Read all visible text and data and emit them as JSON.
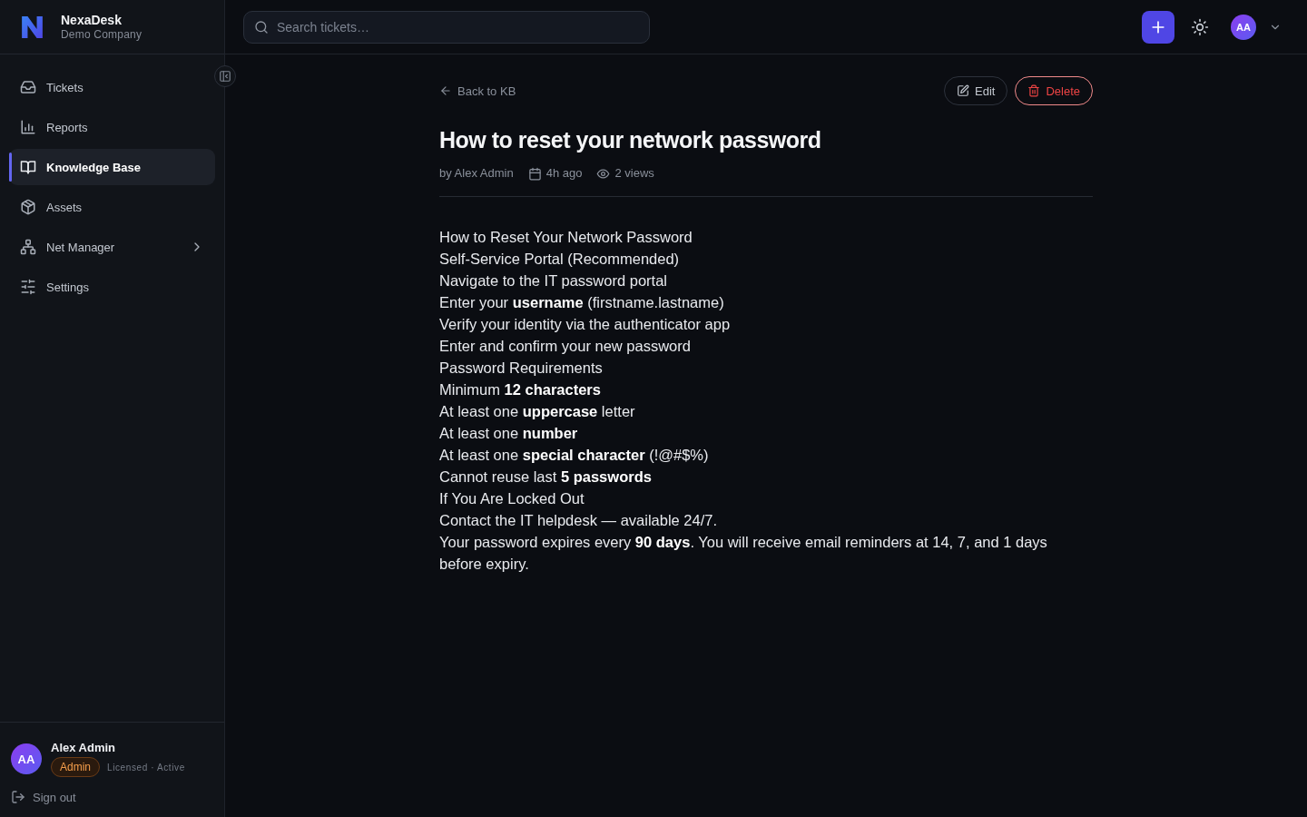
{
  "app": {
    "name": "NexaDesk",
    "company": "Demo Company"
  },
  "sidebar": {
    "items": [
      {
        "label": "Tickets",
        "kind": "link",
        "selected": false
      },
      {
        "label": "Reports",
        "kind": "link",
        "selected": false
      },
      {
        "label": "Knowledge Base",
        "kind": "link",
        "selected": true
      },
      {
        "label": "Assets",
        "kind": "link",
        "selected": false
      },
      {
        "label": "Net Manager",
        "kind": "group",
        "selected": false
      },
      {
        "label": "Settings",
        "kind": "link",
        "selected": false
      }
    ],
    "user": {
      "initials": "AA",
      "name": "Alex Admin",
      "role": "Admin",
      "license": "Licensed · Active"
    },
    "sign_out": "Sign out"
  },
  "topbar": {
    "search": {
      "placeholder": "Search tickets…"
    },
    "avatar": "AA"
  },
  "article": {
    "back_link": "Back to KB",
    "actions": [
      {
        "label": "Edit",
        "kind": "edit"
      },
      {
        "label": "Delete",
        "kind": "delete"
      }
    ],
    "title": "How to reset your network password",
    "author": "by Alex Admin",
    "time": "4h ago",
    "views": "2 views",
    "body": [
      "How to Reset Your Network Password",
      "Self-Service Portal (Recommended)",
      "Navigate to the IT password portal",
      "Enter your **username** (firstname.lastname)",
      "Verify your identity via the authenticator app",
      "Enter and confirm your new password",
      "Password Requirements",
      "Minimum **12 characters**",
      "At least one **uppercase** letter",
      "At least one **number**",
      "At least one **special character** (!@#$%)",
      "Cannot reuse last **5 passwords**",
      "If You Are Locked Out",
      "Contact the IT helpdesk — available 24/7.",
      "Your password expires every **90 days**. You will receive email reminders at 14, 7, and 1 days before expiry."
    ]
  }
}
